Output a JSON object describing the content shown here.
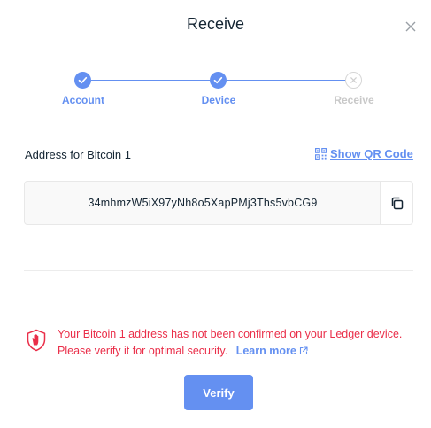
{
  "modal": {
    "title": "Receive",
    "close_icon": "close-icon"
  },
  "stepper": {
    "steps": [
      {
        "label": "Account",
        "status": "done"
      },
      {
        "label": "Device",
        "status": "done"
      },
      {
        "label": "Receive",
        "status": "pending"
      }
    ],
    "accent": "#6490f1"
  },
  "address": {
    "label": "Address for Bitcoin 1",
    "show_qr_label": "Show QR Code",
    "value": "34mhmzW5iX97yNh8o5XapPMj3Ths5vbCG9",
    "copy_icon": "copy-icon"
  },
  "warning": {
    "message": "Your Bitcoin 1 address has not been confirmed on your Ledger device. Please verify it for optimal security.",
    "learn_more": "Learn more",
    "color": "#ea2e49"
  },
  "actions": {
    "verify_label": "Verify"
  }
}
